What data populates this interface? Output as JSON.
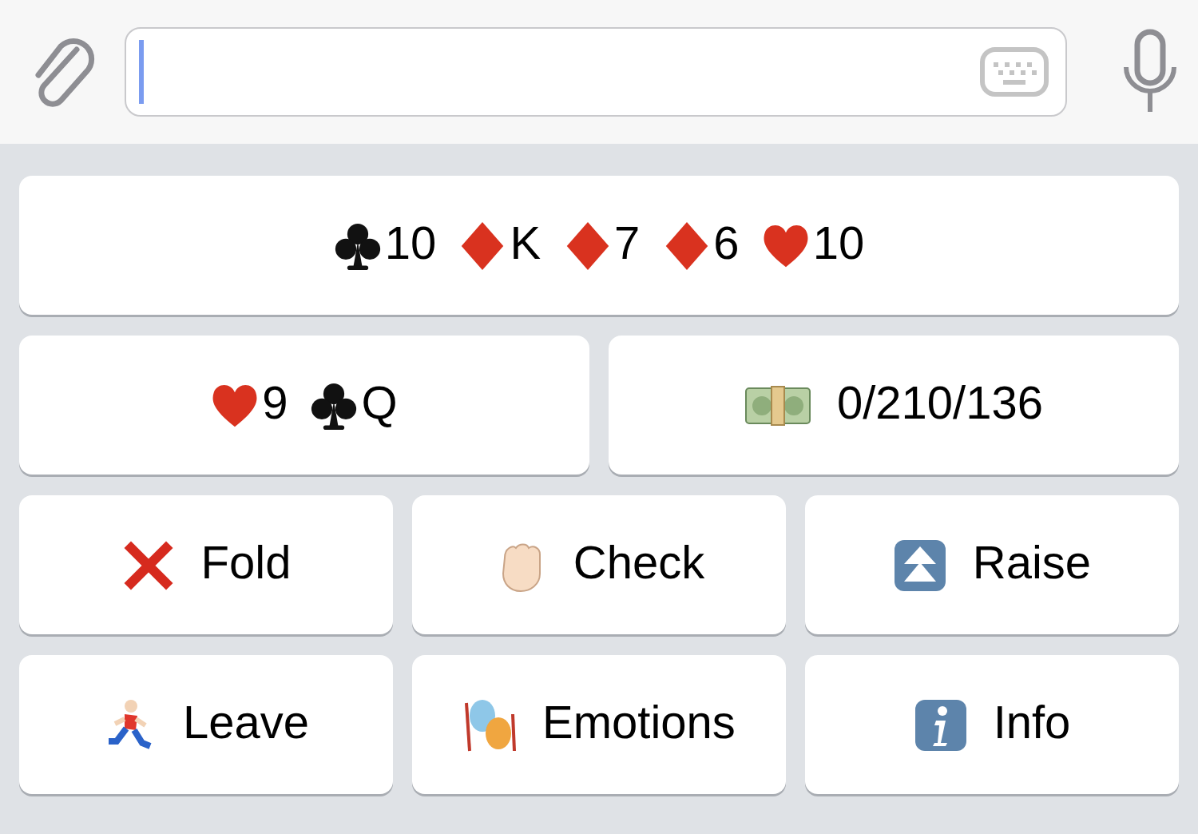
{
  "keyboard": {
    "rows": [
      {
        "buttons": [
          {
            "kind": "cards",
            "cards": [
              {
                "kind": "club",
                "rank": "10"
              },
              {
                "kind": "diamond",
                "rank": "K"
              },
              {
                "kind": "diamond",
                "rank": "7"
              },
              {
                "kind": "diamond",
                "rank": "6"
              },
              {
                "kind": "heart",
                "rank": "10"
              }
            ]
          }
        ]
      },
      {
        "buttons": [
          {
            "kind": "cards",
            "cards": [
              {
                "kind": "heart",
                "rank": "9"
              },
              {
                "kind": "club",
                "rank": "Q"
              }
            ]
          },
          {
            "kind": "money",
            "label": "0/210/136"
          }
        ]
      },
      {
        "buttons": [
          {
            "kind": "fold",
            "label": "Fold"
          },
          {
            "kind": "check",
            "label": "Check"
          },
          {
            "kind": "raise",
            "label": "Raise"
          }
        ]
      },
      {
        "buttons": [
          {
            "kind": "leave",
            "label": "Leave"
          },
          {
            "kind": "emotions",
            "label": "Emotions"
          },
          {
            "kind": "info",
            "label": "Info"
          }
        ]
      }
    ]
  }
}
